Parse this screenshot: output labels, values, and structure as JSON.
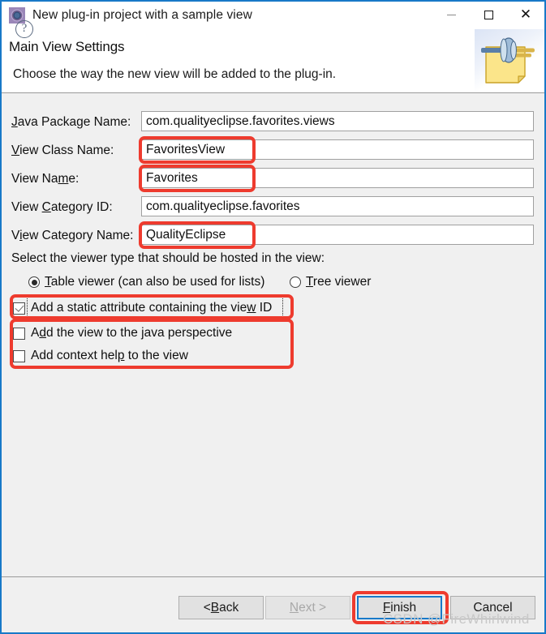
{
  "window": {
    "title": "New plug-in project with a sample view",
    "app_icon": "eclipse-gear-icon",
    "minimize_label": "Minimize",
    "maximize_label": "Maximize",
    "close_label": "Close"
  },
  "header": {
    "title": "Main View Settings",
    "description": "Choose the way the new view will be added to the plug-in.",
    "banner_icon": "plugin-view-banner-icon"
  },
  "form": {
    "fields": [
      {
        "label_pre": "",
        "label_mnemonic": "J",
        "label_post": "ava Package Name:",
        "value": "com.qualityeclipse.favorites.views",
        "highlighted": false
      },
      {
        "label_pre": "",
        "label_mnemonic": "V",
        "label_post": "iew Class Name:",
        "value": "FavoritesView",
        "highlighted": true
      },
      {
        "label_pre": "View Na",
        "label_mnemonic": "m",
        "label_post": "e:",
        "value": "Favorites",
        "highlighted": true
      },
      {
        "label_pre": "View ",
        "label_mnemonic": "C",
        "label_post": "ategory ID:",
        "value": "com.qualityeclipse.favorites",
        "highlighted": false
      },
      {
        "label_pre": "V",
        "label_mnemonic": "i",
        "label_post": "ew Category Name:",
        "value": "QualityEclipse",
        "highlighted": true
      }
    ]
  },
  "viewer": {
    "prompt": "Select the viewer type that should be hosted in the view:",
    "options": [
      {
        "pre": "",
        "mnemonic": "T",
        "post": "able viewer (can also be used for lists)",
        "selected": true
      },
      {
        "pre": "",
        "mnemonic": "T",
        "post": "ree viewer",
        "selected": false
      }
    ]
  },
  "options": {
    "checkboxes": [
      {
        "pre": "Add a static attribute containing the vie",
        "mnemonic": "w",
        "post": " ID",
        "checked": true,
        "focused": true
      },
      {
        "pre": "A",
        "mnemonic": "d",
        "post": "d the view to the java perspective",
        "checked": false,
        "focused": false
      },
      {
        "pre": "Add context hel",
        "mnemonic": "p",
        "post": " to the view",
        "checked": false,
        "focused": false
      }
    ]
  },
  "footer": {
    "help_label": "?",
    "buttons": [
      {
        "pre": "< ",
        "mnemonic": "B",
        "post": "ack",
        "state": "enabled",
        "focused": false
      },
      {
        "pre": "",
        "mnemonic": "N",
        "post": "ext >",
        "state": "disabled",
        "focused": false
      },
      {
        "pre": "",
        "mnemonic": "F",
        "post": "inish",
        "state": "enabled",
        "focused": true
      },
      {
        "pre": "Cancel",
        "mnemonic": "",
        "post": "",
        "state": "enabled",
        "focused": false
      }
    ]
  },
  "watermark": "CSDN @FireWhirlwind",
  "colors": {
    "window_border": "#1879c8",
    "content_bg": "#f0f0f0",
    "annotation_red": "#ee3b2e",
    "focus_blue": "#1879c8"
  }
}
